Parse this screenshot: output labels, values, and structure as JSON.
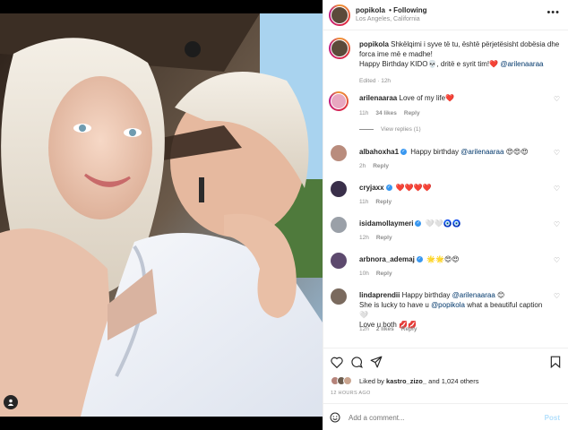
{
  "post": {
    "author": "popikola",
    "follow_state": "• Following",
    "location": "Los Angeles, California",
    "caption": {
      "text_line1": "Shkëlqimi i syve të tu, është përjetësisht dobësia dhe",
      "text_line2": "forca ime më e madhe!",
      "text_line3": "Happy Birthday KIDO💀, dritë e syrit tim!",
      "heart": "❤️",
      "mention": "@arilenaaraa",
      "meta": "Edited · 12h"
    },
    "likes_text_prefix": "Liked by",
    "likes_user": "kastro_zizo_",
    "likes_text_suffix": "and 1,024 others",
    "time_ago": "12 HOURS AGO",
    "add_comment_placeholder": "Add a comment...",
    "post_label": "Post"
  },
  "comments": [
    {
      "user": "arilenaaraa",
      "text": "Love of my life",
      "emoji": "❤️",
      "time": "11h",
      "likes": "34 likes",
      "reply": "Reply",
      "view_replies": "View replies (1)"
    },
    {
      "user": "albahoxha1",
      "verified": true,
      "text": "Happy birthday",
      "mention": "@arilenaaraa",
      "emoji": "😍😍😍",
      "time": "2h",
      "reply": "Reply"
    },
    {
      "user": "cryjaxx",
      "verified": true,
      "emoji": "❤️❤️❤️❤️",
      "time": "11h",
      "reply": "Reply"
    },
    {
      "user": "isidamollaymeri",
      "verified": true,
      "emoji": "🤍🤍🧿🧿",
      "time": "12h",
      "reply": "Reply"
    },
    {
      "user": "arbnora_ademaj",
      "verified": true,
      "emoji": "🌟🌟😍😍",
      "time": "10h",
      "reply": "Reply"
    },
    {
      "user": "lindaprendii",
      "text1": "Happy birthday",
      "mention1": "@arilenaaraa",
      "emoji1": "😊",
      "text2a": "She is lucky to have u",
      "mention2": "@popikola",
      "text2b": "what a beautiful caption",
      "emoji2": "🤍",
      "text3": "Love u both",
      "emoji3": "💋💋",
      "time": "12h",
      "likes": "2 likes",
      "reply": "Reply"
    }
  ],
  "icons": {
    "heart": "heart-icon",
    "comment": "comment-icon",
    "share": "share-icon",
    "save": "bookmark-icon",
    "emoji": "emoji-icon",
    "more": "more-options-icon",
    "user": "user-tag-icon"
  },
  "colors": {
    "link": "#00376b",
    "muted": "#8e8e8e",
    "verified": "#3897f0",
    "post_button_disabled": "#b2dffc"
  }
}
